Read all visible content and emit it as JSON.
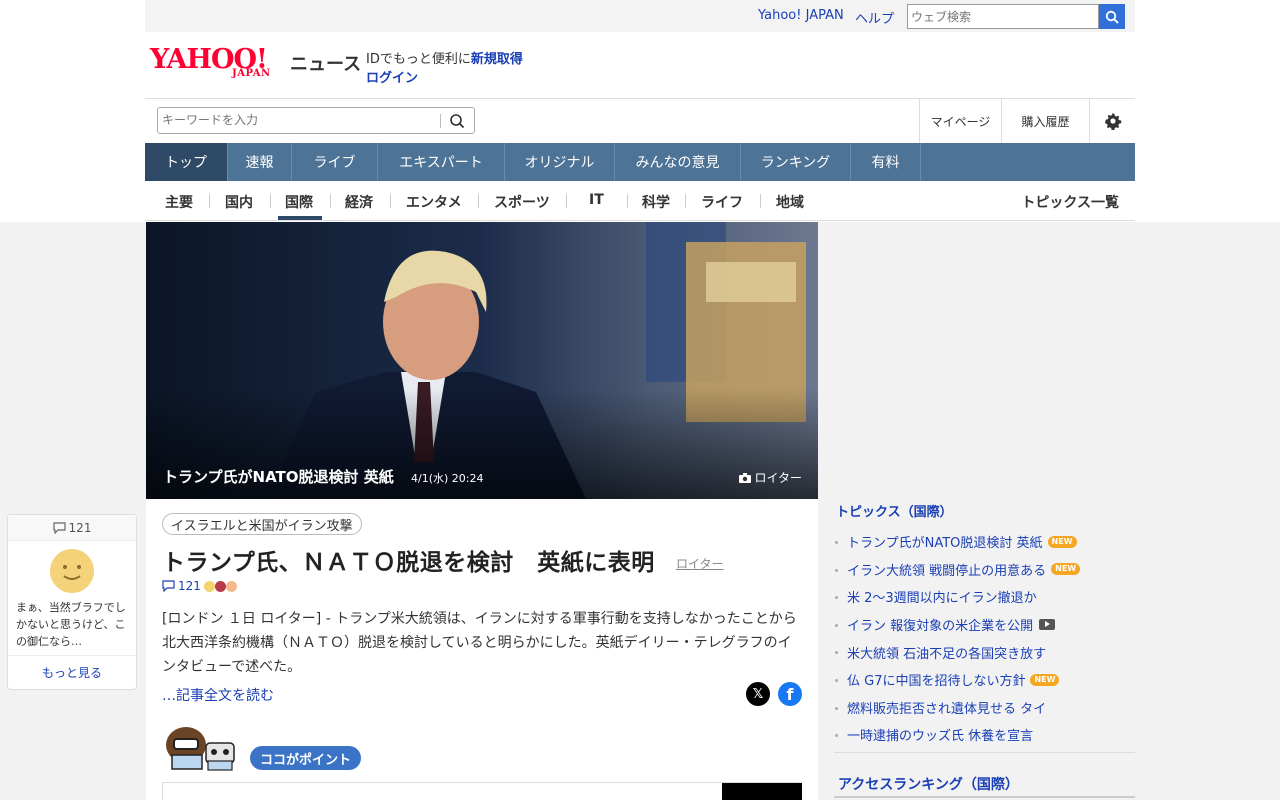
{
  "utility": {
    "yahoo_japan": "Yahoo! JAPAN",
    "help": "ヘルプ",
    "web_search_placeholder": "ウェブ検索"
  },
  "header": {
    "logo_text": "YAHOO!",
    "logo_sub": "JAPAN",
    "service": "ニュース",
    "id_prompt": "IDでもっと便利に",
    "signup": "新規取得",
    "login": "ログイン"
  },
  "search": {
    "placeholder": "キーワードを入力"
  },
  "header_buttons": {
    "mypage": "マイページ",
    "purchase_history": "購入履歴"
  },
  "main_nav": [
    "トップ",
    "速報",
    "ライブ",
    "エキスパート",
    "オリジナル",
    "みんなの意見",
    "ランキング",
    "有料"
  ],
  "sub_nav": [
    "主要",
    "国内",
    "国際",
    "経済",
    "エンタメ",
    "スポーツ",
    "IT",
    "科学",
    "ライフ",
    "地域"
  ],
  "topics_all": "トピックス一覧",
  "hero": {
    "title": "トランプ氏がNATO脱退検討 英紙",
    "date": "4/1(水) 20:24",
    "credit": "ロイター"
  },
  "article": {
    "tag": "イスラエルと米国がイラン攻撃",
    "title": "トランプ氏、ＮＡＴＯ脱退を検討　英紙に表明",
    "source": "ロイター",
    "comment_count": "121",
    "body": "[ロンドン １日 ロイター] - トランプ米大統領は、イランに対する軍事行動を支持しなかったことから北大西洋条約機構（ＮＡＴＯ）脱退を検討していると明らかにした。英紙デイリー・テレグラフのインタビューで述べた。",
    "read_more": "…記事全文を読む",
    "point_label": "ココがポイント"
  },
  "comment_card": {
    "count": "121",
    "text": "まぁ、当然ブラフでしかないと思うけど、この御仁なら…",
    "more": "もっと見る"
  },
  "sidebar": {
    "topics_heading": "トピックス（国際）",
    "topics": [
      {
        "text": "トランプ氏がNATO脱退検討 英紙",
        "badge": "NEW"
      },
      {
        "text": "イラン大統領 戦闘停止の用意ある",
        "badge": "NEW"
      },
      {
        "text": "米 2～3週間以内にイラン撤退か",
        "badge": ""
      },
      {
        "text": "イラン 報復対象の米企業を公開",
        "badge": "",
        "video": true
      },
      {
        "text": "米大統領 石油不足の各国突き放す",
        "badge": ""
      },
      {
        "text": "仏 G7に中国を招待しない方針",
        "badge": "NEW"
      },
      {
        "text": "燃料販売拒否され遺体見せる タイ",
        "badge": ""
      },
      {
        "text": "一時逮捕のウッズ氏 休養を宣言",
        "badge": ""
      }
    ],
    "ranking_heading": "アクセスランキング（国際）"
  },
  "colors": {
    "nav_bg": "#4d7397",
    "nav_active": "#2f4a66",
    "link": "#1a3fb5",
    "brand": "#ff0033",
    "new_badge": "#f5a623"
  }
}
